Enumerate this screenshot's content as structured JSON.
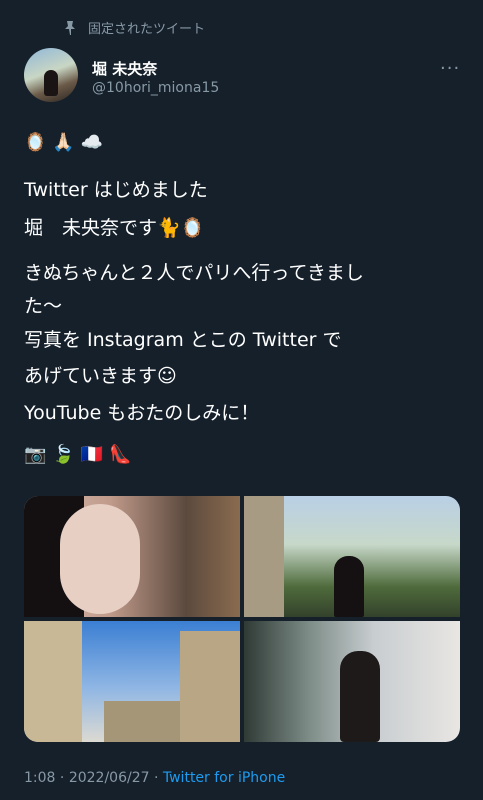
{
  "pinned_label": "固定されたツイート",
  "user": {
    "name": "堀 未央奈",
    "handle": "@10hori_miona15"
  },
  "more_label": "···",
  "tweet": {
    "emojis_top": [
      "🪞",
      "🙏🏻",
      "☁️"
    ],
    "lines": [
      "Twitter はじめました",
      "堀　未央奈です🐈🪞",
      "きぬちゃんと２人でパリへ行ってきまし",
      "た〜",
      "写真を Instagram とこの Twitter で",
      "あげていきます☺︎",
      "YouTube もおたのしみに！"
    ],
    "emojis_bottom": [
      "📷",
      "🍃",
      "🇫🇷",
      "👠"
    ]
  },
  "meta": {
    "time": "1:08",
    "separator": " · ",
    "date": "2022/06/27",
    "source": "Twitter for iPhone"
  },
  "colors": {
    "background": "#15202b",
    "secondary_text": "#8899a6",
    "link": "#1d9bf0"
  }
}
